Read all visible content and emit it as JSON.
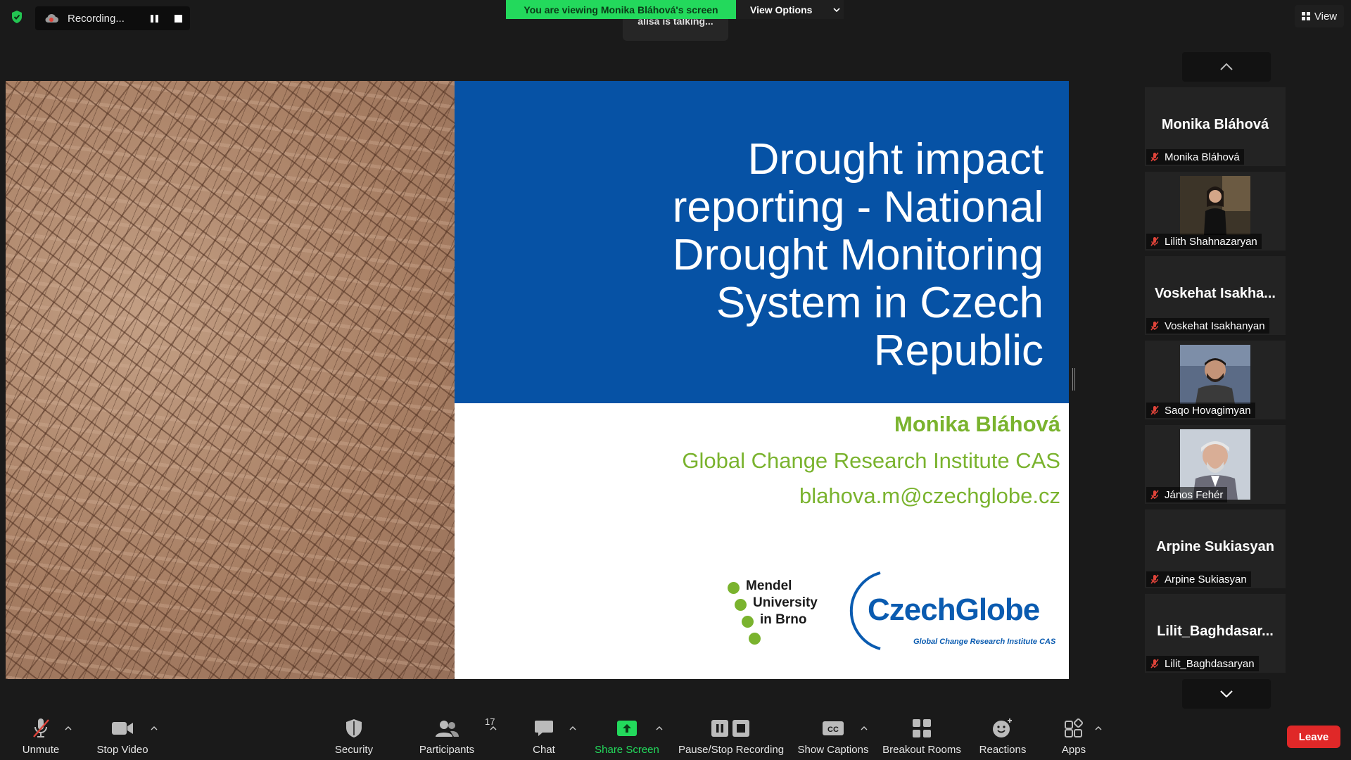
{
  "recording": {
    "label": "Recording..."
  },
  "banner": {
    "viewing": "You are viewing Monika Bláhová's screen",
    "view_options": "View Options"
  },
  "talking_indicator": "alisa is talking...",
  "view_button": "View",
  "slide": {
    "title_lines": [
      "Drought impact",
      "reporting - National",
      "Drought Monitoring",
      "System in Czech",
      "Republic"
    ],
    "author": "Monika Bláhová",
    "institute": "Global Change Research Institute CAS",
    "email": "blahova.m@czechglobe.cz",
    "mendel_logo": [
      "Mendel",
      "University",
      "in Brno"
    ],
    "czechglobe_logo": {
      "word": "CzechGlobe",
      "subtitle": "Global Change Research Institute CAS"
    }
  },
  "participants": [
    {
      "tile_name": "Monika Bláhová",
      "label": "Monika Bláhová",
      "video": false
    },
    {
      "tile_name": "",
      "label": "Lilith Shahnazaryan",
      "video": true
    },
    {
      "tile_name": "Voskehat  Isakha...",
      "label": "Voskehat Isakhanyan",
      "video": false
    },
    {
      "tile_name": "",
      "label": "Saqo Hovagimyan",
      "video": true
    },
    {
      "tile_name": "",
      "label": "János Fehér",
      "video": true
    },
    {
      "tile_name": "Arpine Sukiasyan",
      "label": "Arpine Sukiasyan",
      "video": false
    },
    {
      "tile_name": "Lilit_Baghdasar...",
      "label": "Lilit_Baghdasaryan",
      "video": false
    }
  ],
  "toolbar": {
    "unmute": "Unmute",
    "stop_video": "Stop Video",
    "security": "Security",
    "participants": "Participants",
    "participants_count": "17",
    "chat": "Chat",
    "share_screen": "Share Screen",
    "pause_stop_recording": "Pause/Stop Recording",
    "show_captions": "Show Captions",
    "captions_badge": "CC",
    "breakout_rooms": "Breakout Rooms",
    "reactions": "Reactions",
    "apps": "Apps",
    "leave": "Leave"
  },
  "colors": {
    "banner_green": "#23d95c",
    "slide_blue": "#0652a5",
    "slide_green": "#7ab32e",
    "leave_red": "#e02828",
    "muted_mic_red": "#e0443a"
  }
}
